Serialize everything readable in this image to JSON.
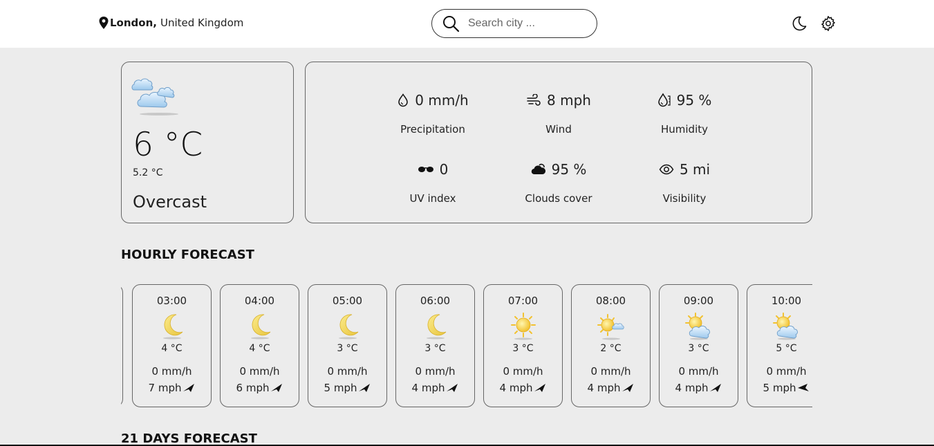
{
  "header": {
    "city": "London,",
    "country": "United Kingdom",
    "search_placeholder": "Search city ...",
    "theme_icon": "moon-icon",
    "settings_icon": "gear-icon"
  },
  "current": {
    "icon": "overcast-clouds-icon",
    "temperature": "6 °C",
    "feels_like": "5.2 °C",
    "condition": "Overcast"
  },
  "details": [
    {
      "icon": "droplet-icon",
      "value": "0 mm/h",
      "label": "Precipitation"
    },
    {
      "icon": "wind-icon",
      "value": "8 mph",
      "label": "Wind"
    },
    {
      "icon": "humidity-icon",
      "value": "95 %",
      "label": "Humidity"
    },
    {
      "icon": "sunglasses-icon",
      "value": "0",
      "label": "UV index"
    },
    {
      "icon": "cloud-icon",
      "value": "95 %",
      "label": "Clouds cover"
    },
    {
      "icon": "eye-icon",
      "value": "5 mi",
      "label": "Visibility"
    }
  ],
  "hourly_title": "HOURLY FORECAST",
  "hourly": [
    {
      "time": "03:00",
      "icon": "moon-icon",
      "temp": "4 °C",
      "precip": "0 mm/h",
      "wind": "7 mph"
    },
    {
      "time": "04:00",
      "icon": "moon-icon",
      "temp": "4 °C",
      "precip": "0 mm/h",
      "wind": "6 mph"
    },
    {
      "time": "05:00",
      "icon": "moon-icon",
      "temp": "3 °C",
      "precip": "0 mm/h",
      "wind": "5 mph"
    },
    {
      "time": "06:00",
      "icon": "moon-icon",
      "temp": "3 °C",
      "precip": "0 mm/h",
      "wind": "4 mph"
    },
    {
      "time": "07:00",
      "icon": "sun-icon",
      "temp": "3 °C",
      "precip": "0 mm/h",
      "wind": "4 mph"
    },
    {
      "time": "08:00",
      "icon": "sun-small-cloud-icon",
      "temp": "2 °C",
      "precip": "0 mm/h",
      "wind": "4 mph"
    },
    {
      "time": "09:00",
      "icon": "sun-cloud-icon",
      "temp": "3 °C",
      "precip": "0 mm/h",
      "wind": "4 mph"
    },
    {
      "time": "10:00",
      "icon": "sun-cloud-icon",
      "temp": "5 °C",
      "precip": "0 mm/h",
      "wind": "5 mph"
    }
  ],
  "daily_title": "21 DAYS FORECAST"
}
